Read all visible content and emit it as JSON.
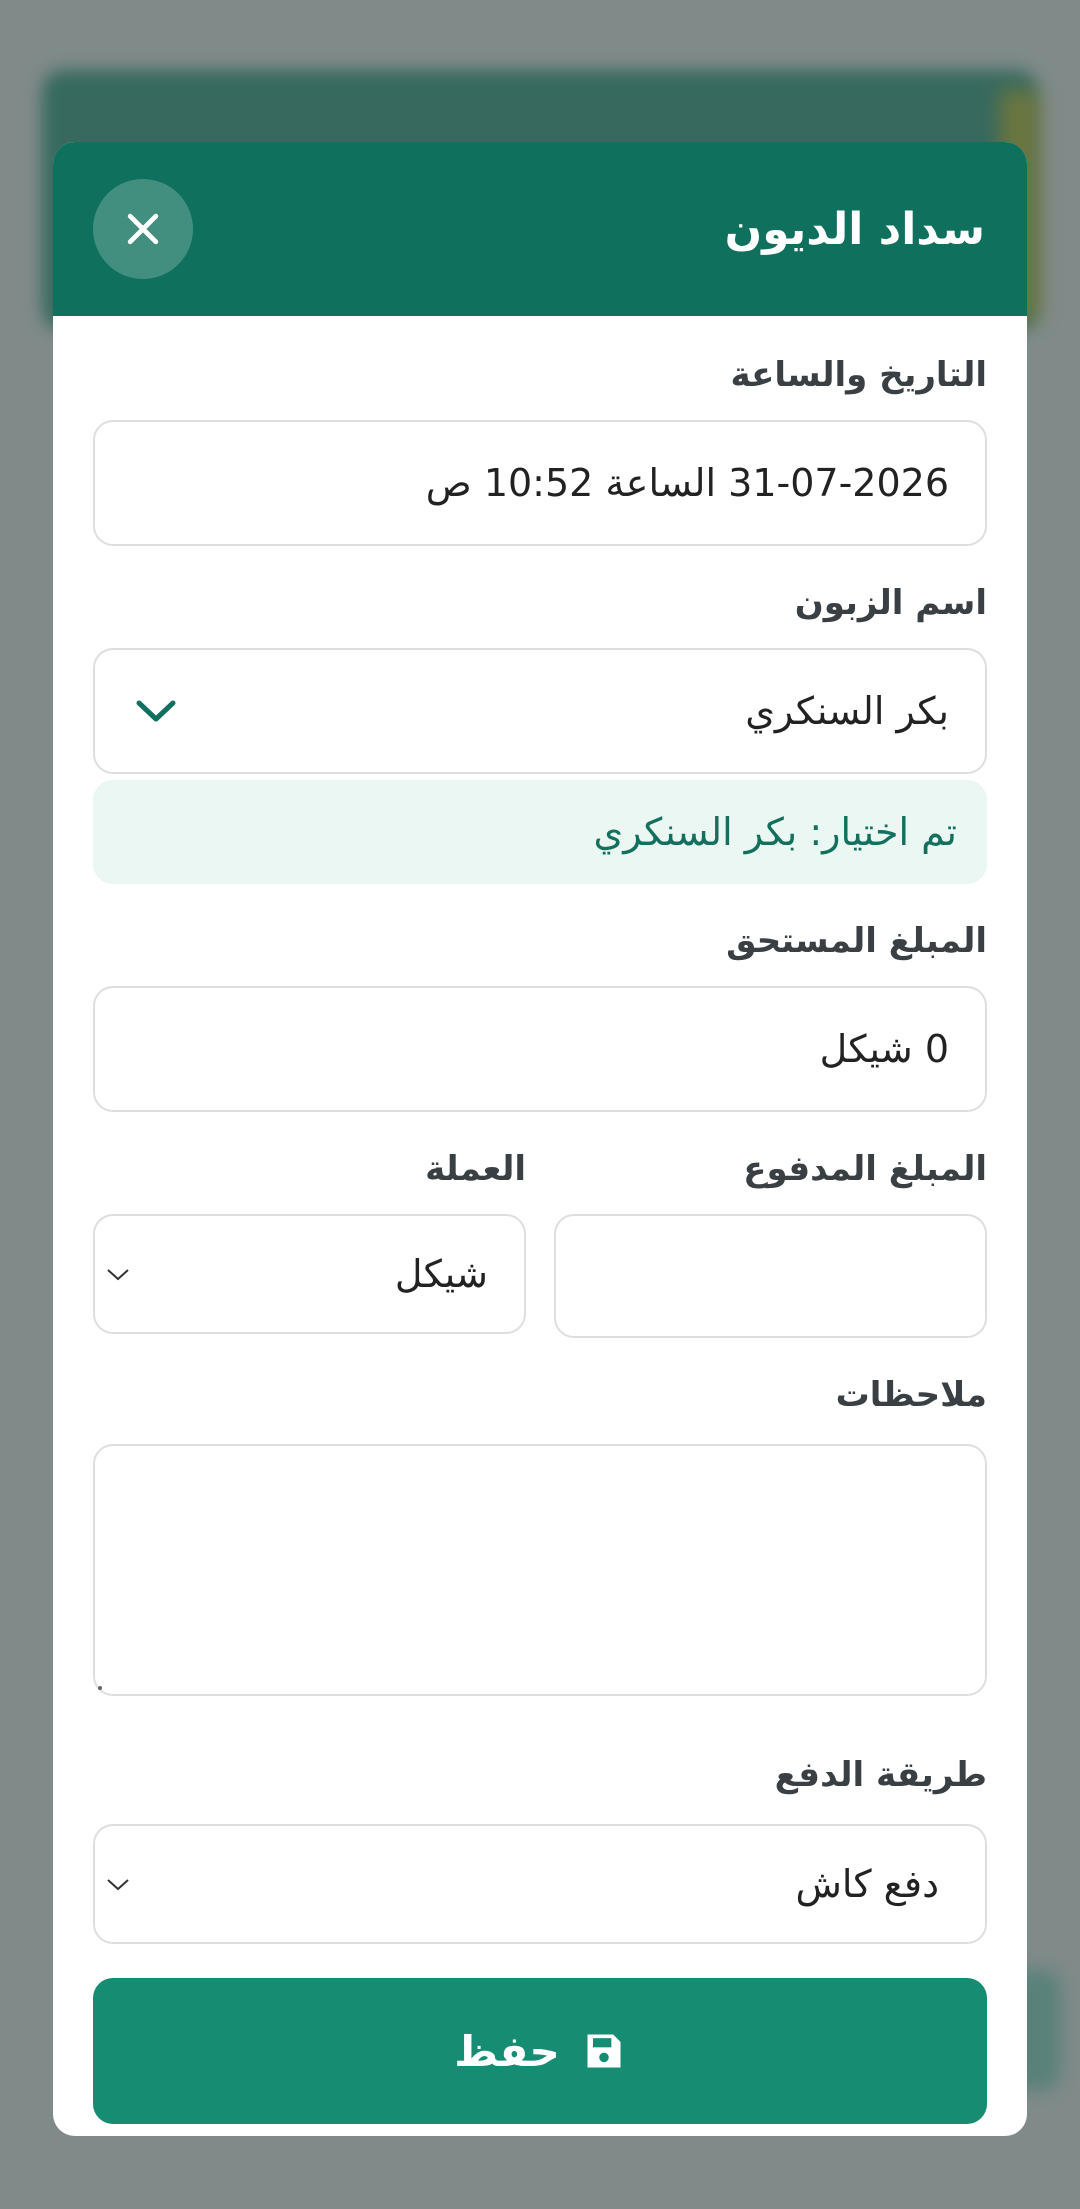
{
  "modal": {
    "title": "سداد الديون",
    "close_icon": "close-icon"
  },
  "form": {
    "datetime_label": "التاريخ والساعة",
    "datetime_value": "31-07-2026 الساعة 10:52 ص",
    "customer_label": "اسم الزبون",
    "customer_value": "بكر السنكري",
    "customer_selected_note": "تم اختيار: بكر السنكري",
    "due_amount_label": "المبلغ المستحق",
    "due_amount_value": "0 شيكل",
    "paid_amount_label": "المبلغ المدفوع",
    "paid_amount_value": "",
    "currency_label": "العملة",
    "currency_value": "شيكل",
    "notes_label": "ملاحظات",
    "notes_value": "",
    "payment_method_label": "طريقة الدفع",
    "payment_method_value": "دفع كاش",
    "save_label": "حفظ"
  },
  "colors": {
    "header": "#0e705d",
    "accent": "#168c73",
    "note_bg": "#eaf7f2",
    "note_text": "#13705d"
  }
}
